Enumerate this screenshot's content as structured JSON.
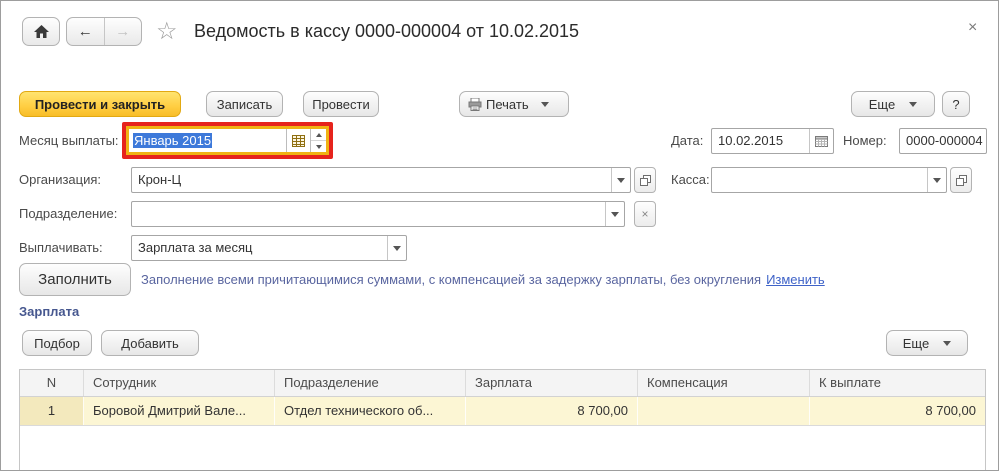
{
  "window": {
    "title": "Ведомость в кассу 0000-000004 от 10.02.2015",
    "close": "×",
    "help": "?"
  },
  "icons": {
    "star": "☆",
    "back_arrow": "←",
    "forward_arrow": "→",
    "clear_x": "×"
  },
  "toolbar": {
    "post_and_close": "Провести и закрыть",
    "write": "Записать",
    "post": "Провести",
    "print": "Печать",
    "more": "Еще"
  },
  "form": {
    "month_label": "Месяц выплаты:",
    "month_value": "Январь 2015",
    "date_label": "Дата:",
    "date_value": "10.02.2015",
    "number_label": "Номер:",
    "number_value": "0000-000004",
    "organization_label": "Организация:",
    "organization_value": "Крон-Ц",
    "cashbox_label": "Касса:",
    "cashbox_value": "",
    "department_label": "Подразделение:",
    "department_value": "",
    "payout_label": "Выплачивать:",
    "payout_value": "Зарплата за месяц"
  },
  "fill": {
    "button": "Заполнить",
    "note": "Заполнение всеми причитающимися суммами, с компенсацией за задержку зарплаты, без округления",
    "change_link": "Изменить"
  },
  "salary_section": {
    "title": "Зарплата",
    "pick_button": "Подбор",
    "add_button": "Добавить",
    "more_button": "Еще"
  },
  "table": {
    "headers": [
      "N",
      "Сотрудник",
      "Подразделение",
      "Зарплата",
      "Компенсация",
      "К выплате"
    ],
    "rows": [
      {
        "n": "1",
        "employee": "Боровой Дмитрий Вале...",
        "department": "Отдел технического об...",
        "salary": "8 700,00",
        "compensation": "",
        "to_pay": "8 700,00"
      }
    ]
  },
  "colors": {
    "accent_yellow": "#ffce42",
    "highlight_red": "#e6231c",
    "focus_yellow": "#f0b213",
    "selection_blue": "#3d79da",
    "link_blue": "#3f63c8",
    "note_blue": "#5a66a0",
    "row_yellow": "#fcf6d4"
  }
}
